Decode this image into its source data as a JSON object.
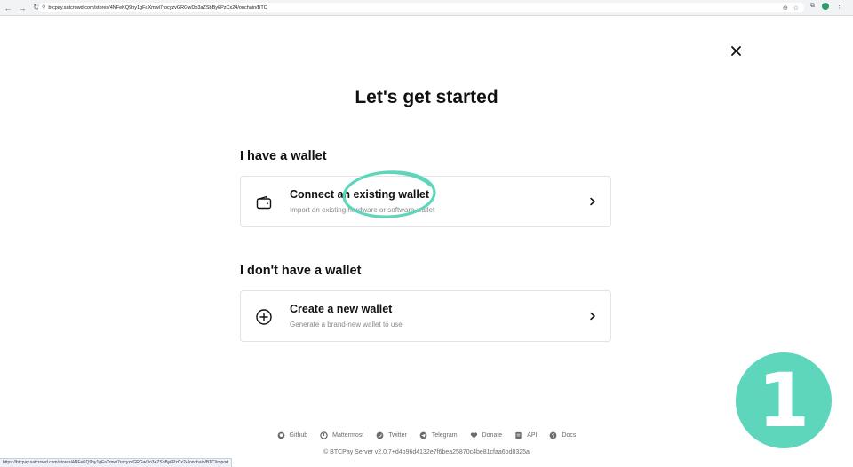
{
  "browser": {
    "url": "btcpay.satcrowd.com/stores/4NFeKQ9hy1gFaXmwi7rocyzvGRGwDo3aZSbBy6PzCx24/onchain/BTC",
    "status_url": "https://btcpay.satcrowd.com/stores/4NFeKQ9hy1gFaXmwi7rocyzvGRGwDo3aZSbBy6PzCx24/onchain/BTC/import"
  },
  "page": {
    "title": "Let's get started"
  },
  "sections": [
    {
      "heading": "I have a wallet",
      "option": {
        "title": "Connect an existing wallet",
        "subtitle": "Import an existing hardware or software wallet",
        "icon": "wallet-icon"
      }
    },
    {
      "heading": "I don't have a wallet",
      "option": {
        "title": "Create a new wallet",
        "subtitle": "Generate a brand-new wallet to use",
        "icon": "plus-circle-icon"
      }
    }
  ],
  "footer": {
    "links": [
      {
        "label": "Github",
        "icon": "github-icon"
      },
      {
        "label": "Mattermost",
        "icon": "mattermost-icon"
      },
      {
        "label": "Twitter",
        "icon": "twitter-icon"
      },
      {
        "label": "Telegram",
        "icon": "telegram-icon"
      },
      {
        "label": "Donate",
        "icon": "heart-icon"
      },
      {
        "label": "API",
        "icon": "api-icon"
      },
      {
        "label": "Docs",
        "icon": "docs-icon"
      }
    ],
    "copyright": "© BTCPay Server v2.0.7+d4b96d4132e7f6bea25870c4be81cfaa6bd8325a"
  },
  "annotation": {
    "step_number": "1",
    "badge_color": "#5dd6bb"
  }
}
